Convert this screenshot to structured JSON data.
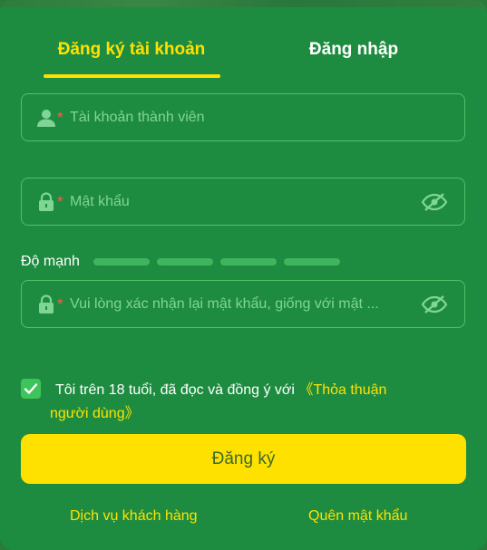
{
  "tabs": {
    "register": "Đăng ký tài khoản",
    "login": "Đăng nhập"
  },
  "fields": {
    "account": {
      "required_mark": "*",
      "placeholder": "Tài khoản thành viên"
    },
    "password": {
      "required_mark": "*",
      "placeholder": "Mật khẩu"
    },
    "confirm": {
      "required_mark": "*",
      "placeholder": "Vui lòng xác nhận lại mật khẩu, giống với mật ..."
    }
  },
  "strength": {
    "label": "Độ mạnh",
    "segments": 4
  },
  "agreement": {
    "checked": true,
    "text": "Tôi trên 18 tuổi, đã đọc và đồng ý với",
    "link_line1": "《Thỏa thuận",
    "link_line2": "người dùng》"
  },
  "submit_label": "Đăng ký",
  "footer": {
    "support": "Dịch vụ khách hàng",
    "forgot": "Quên mật khẩu"
  },
  "colors": {
    "background": "#1e8c40",
    "accent": "#ffe100",
    "border": "#4fc06a",
    "placeholder": "#7fd595",
    "required": "#ff5a4e"
  }
}
